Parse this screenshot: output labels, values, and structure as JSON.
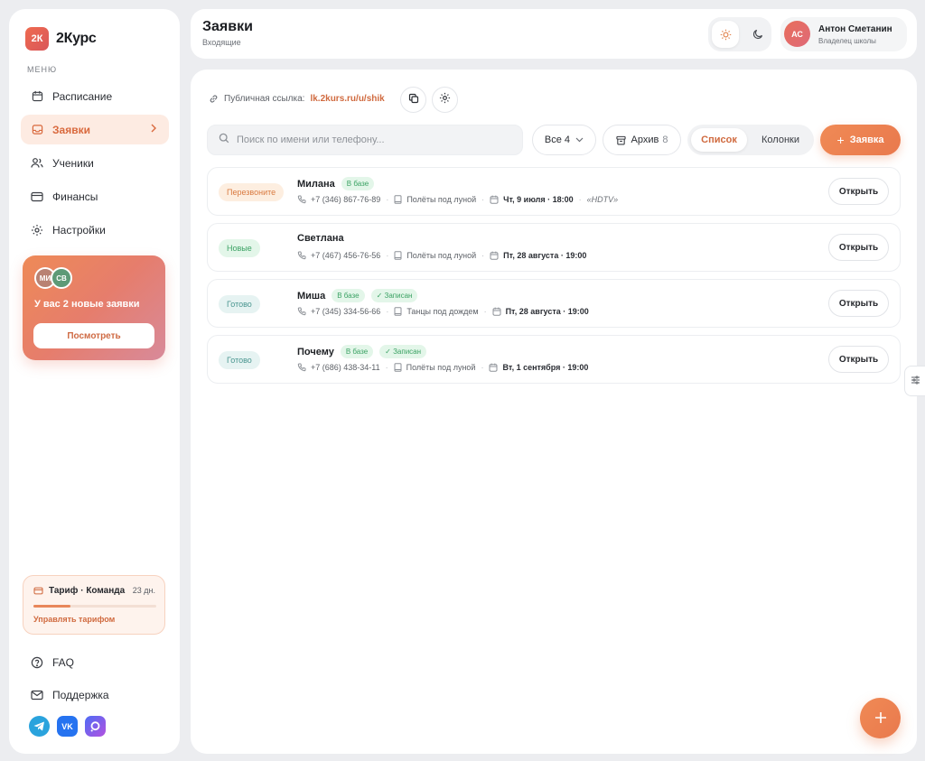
{
  "brand": {
    "mark": "2К",
    "name": "2Курс"
  },
  "sidebar": {
    "menu_label": "МЕНЮ",
    "items": [
      {
        "label": "Расписание",
        "icon": "calendar-icon"
      },
      {
        "label": "Заявки",
        "icon": "inbox-icon",
        "active": true
      },
      {
        "label": "Ученики",
        "icon": "users-icon"
      },
      {
        "label": "Финансы",
        "icon": "card-icon"
      },
      {
        "label": "Настройки",
        "icon": "gear-icon"
      }
    ],
    "promo": {
      "avatar1": "МИ",
      "avatar2": "СВ",
      "text": "У вас 2 новые заявки",
      "button": "Посмотреть"
    },
    "tariff": {
      "title": "Тариф · Команда",
      "days": "23 дн.",
      "progress": 0.3,
      "link": "Управлять тарифом"
    },
    "footer_items": [
      {
        "label": "FAQ",
        "icon": "help-icon"
      },
      {
        "label": "Поддержка",
        "icon": "mail-icon"
      }
    ]
  },
  "header": {
    "title": "Заявки",
    "subtitle": "Входящие",
    "user": {
      "initials": "АС",
      "name": "Антон Сметанин",
      "role": "Владелец школы"
    }
  },
  "toolbar": {
    "public_link_label": "Публичная ссылка:",
    "public_link_url": "lk.2kurs.ru/u/shik",
    "search_placeholder": "Поиск по имени или телефону...",
    "filter_all": "Все 4",
    "archive_label": "Архив",
    "archive_count": "8",
    "view_list": "Список",
    "view_columns": "Колонки",
    "add_label": "Заявка"
  },
  "requests": [
    {
      "status": "Перезвоните",
      "status_color": "orange",
      "name": "Милана",
      "tags": [
        "В базе"
      ],
      "phone": "+7 (346) 867-76-89",
      "course": "Полёты под луной",
      "date": "Чт, 9 июля · 18:00",
      "note": "«HDTV»",
      "open": "Открыть"
    },
    {
      "status": "Новые",
      "status_color": "green",
      "name": "Светлана",
      "tags": [],
      "phone": "+7 (467) 456-76-56",
      "course": "Полёты под луной",
      "date": "Пт, 28 августа · 19:00",
      "note": "",
      "open": "Открыть"
    },
    {
      "status": "Готово",
      "status_color": "teal",
      "name": "Миша",
      "tags": [
        "В базе",
        "✓ Записан"
      ],
      "phone": "+7 (345) 334-56-66",
      "course": "Танцы под дождем",
      "date": "Пт, 28 августа · 19:00",
      "note": "",
      "open": "Открыть"
    },
    {
      "status": "Готово",
      "status_color": "teal",
      "name": "Почему",
      "tags": [
        "В базе",
        "✓ Записан"
      ],
      "phone": "+7 (686) 438-34-11",
      "course": "Полёты под луной",
      "date": "Вт, 1 сентября · 19:00",
      "note": "",
      "open": "Открыть"
    }
  ]
}
